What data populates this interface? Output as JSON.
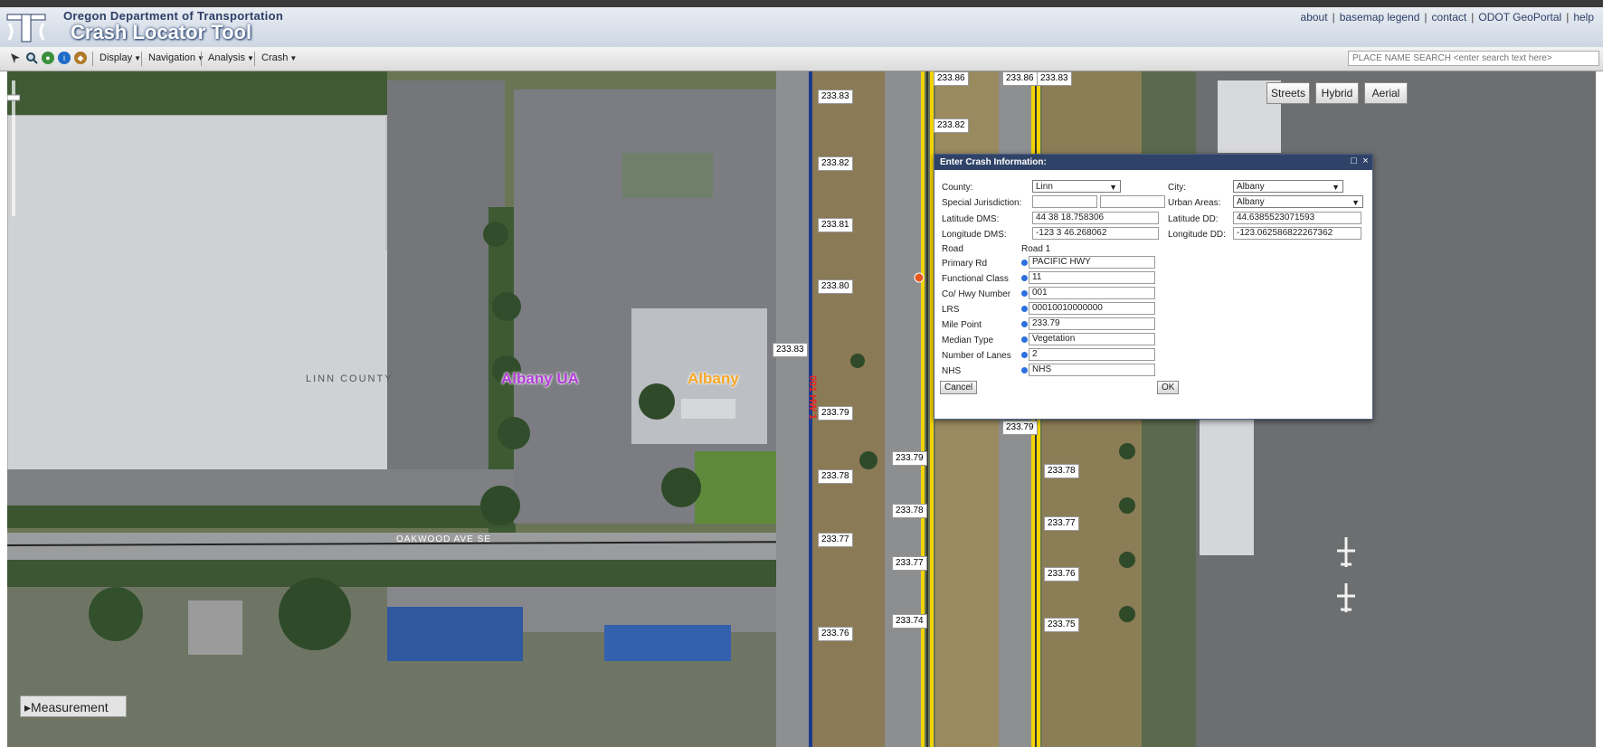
{
  "header": {
    "org": "Oregon Department of Transportation",
    "title": "Crash Locator Tool",
    "links": [
      "about",
      "basemap legend",
      "contact",
      "ODOT GeoPortal",
      "help"
    ]
  },
  "toolbar": {
    "menus": [
      "Display",
      "Navigation",
      "Analysis",
      "Crash"
    ],
    "search_placeholder": "PLACE NAME SEARCH <enter search text here>"
  },
  "map": {
    "types": [
      "Streets",
      "Hybrid",
      "Aerial"
    ],
    "labels": {
      "linn_county": "LINN COUNTY",
      "albany_ua": "Albany UA",
      "albany": "Albany",
      "street": "OAKWOOD AVE SE",
      "hwy": "001 HW 1"
    },
    "milepoints": {
      "col_a": [
        "233.83",
        "233.82",
        "233.81",
        "233.80",
        "233.79",
        "233.78",
        "233.77",
        "233.76"
      ],
      "col_b": [
        "233.83",
        "233.81",
        "233.80",
        "233.79",
        "233.78",
        "233.77",
        "233.76",
        "233.75"
      ],
      "col_c": [
        "233.86",
        "233.82",
        "233.79",
        "233.78",
        "233.77",
        "233.74"
      ],
      "col_d": [
        "233.86",
        "233.79",
        "233.78",
        "233.77",
        "233.76",
        "233.75"
      ],
      "mid": "233.83"
    },
    "measurement": "Measurement",
    "colors": {
      "dialog_header": "#2f4368",
      "radio": "#2c6fe0",
      "albany_ua": "#b23bd8",
      "albany": "#f5a623",
      "road": "#f2d300"
    }
  },
  "dialog": {
    "title": "Enter Crash Information:",
    "county_label": "County:",
    "county_value": "Linn",
    "city_label": "City:",
    "city_value": "Albany",
    "special_label": "Special Jurisdiction:",
    "urban_label": "Urban Areas:",
    "urban_value": "Albany",
    "lat_dms_label": "Latitude DMS:",
    "lat_dms_value": "44 38 18.758306",
    "lat_dd_label": "Latitude DD:",
    "lat_dd_value": "44.6385523071593",
    "lon_dms_label": "Longitude DMS:",
    "lon_dms_value": "-123 3 46.268062",
    "lon_dd_label": "Longitude DD:",
    "lon_dd_value": "-123.062586822267362",
    "road_label": "Road",
    "road1_label": "Road 1",
    "rows": [
      {
        "label": "Primary Rd",
        "value": "PACIFIC HWY"
      },
      {
        "label": "Functional Class",
        "value": "11"
      },
      {
        "label": "Co/ Hwy Number",
        "value": "001"
      },
      {
        "label": "LRS",
        "value": "00010010000000"
      },
      {
        "label": "Mile Point",
        "value": "233.79"
      },
      {
        "label": "Median Type",
        "value": "Vegetation"
      },
      {
        "label": "Number of Lanes",
        "value": "2"
      },
      {
        "label": "NHS",
        "value": "NHS"
      }
    ],
    "cancel": "Cancel",
    "ok": "OK"
  }
}
